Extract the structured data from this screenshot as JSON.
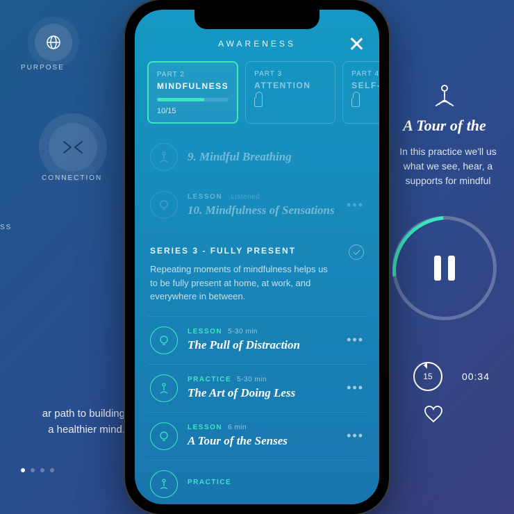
{
  "left": {
    "node1_label": "PURPOSE",
    "node2_label": "CONNECTION",
    "node3_label": "SS",
    "text_line1": "ar path to building",
    "text_line2": "a healthier mind."
  },
  "right": {
    "title": "A Tour of the",
    "desc_line1": "In this practice we'll us",
    "desc_line2": "what we see, hear, a",
    "desc_line3": "supports for mindful",
    "rewind_seconds": "15",
    "time": "00:34"
  },
  "phone": {
    "header_title": "AWARENESS",
    "tabs": [
      {
        "part": "PART 2",
        "name": "MINDFULNESS",
        "count": "10/15",
        "locked": false,
        "active": true
      },
      {
        "part": "PART 3",
        "name": "ATTENTION",
        "count": "",
        "locked": true,
        "active": false
      },
      {
        "part": "PART 4",
        "name": "SELF-AW",
        "count": "",
        "locked": true,
        "active": false
      }
    ],
    "prev_lessons": [
      {
        "meta": "",
        "title": "9. Mindful Breathing"
      },
      {
        "meta_tag": "LESSON",
        "meta_status": "Listened",
        "title": "10. Mindfulness of Sensations"
      }
    ],
    "series": {
      "title": "SERIES 3 - FULLY PRESENT",
      "desc": "Repeating moments of mindfulness helps us to be fully present at home, at work, and everywhere in between."
    },
    "lessons": [
      {
        "tag": "LESSON",
        "dur": "5-30 min",
        "title": "The Pull of Distraction",
        "icon": "bulb"
      },
      {
        "tag": "PRACTICE",
        "dur": "5-30 min",
        "title": "The Art of Doing Less",
        "icon": "yoga"
      },
      {
        "tag": "LESSON",
        "dur": "6 min",
        "title": "A Tour of the Senses",
        "icon": "bulb"
      },
      {
        "tag": "PRACTICE",
        "dur": "",
        "title": "",
        "icon": "yoga"
      }
    ]
  }
}
